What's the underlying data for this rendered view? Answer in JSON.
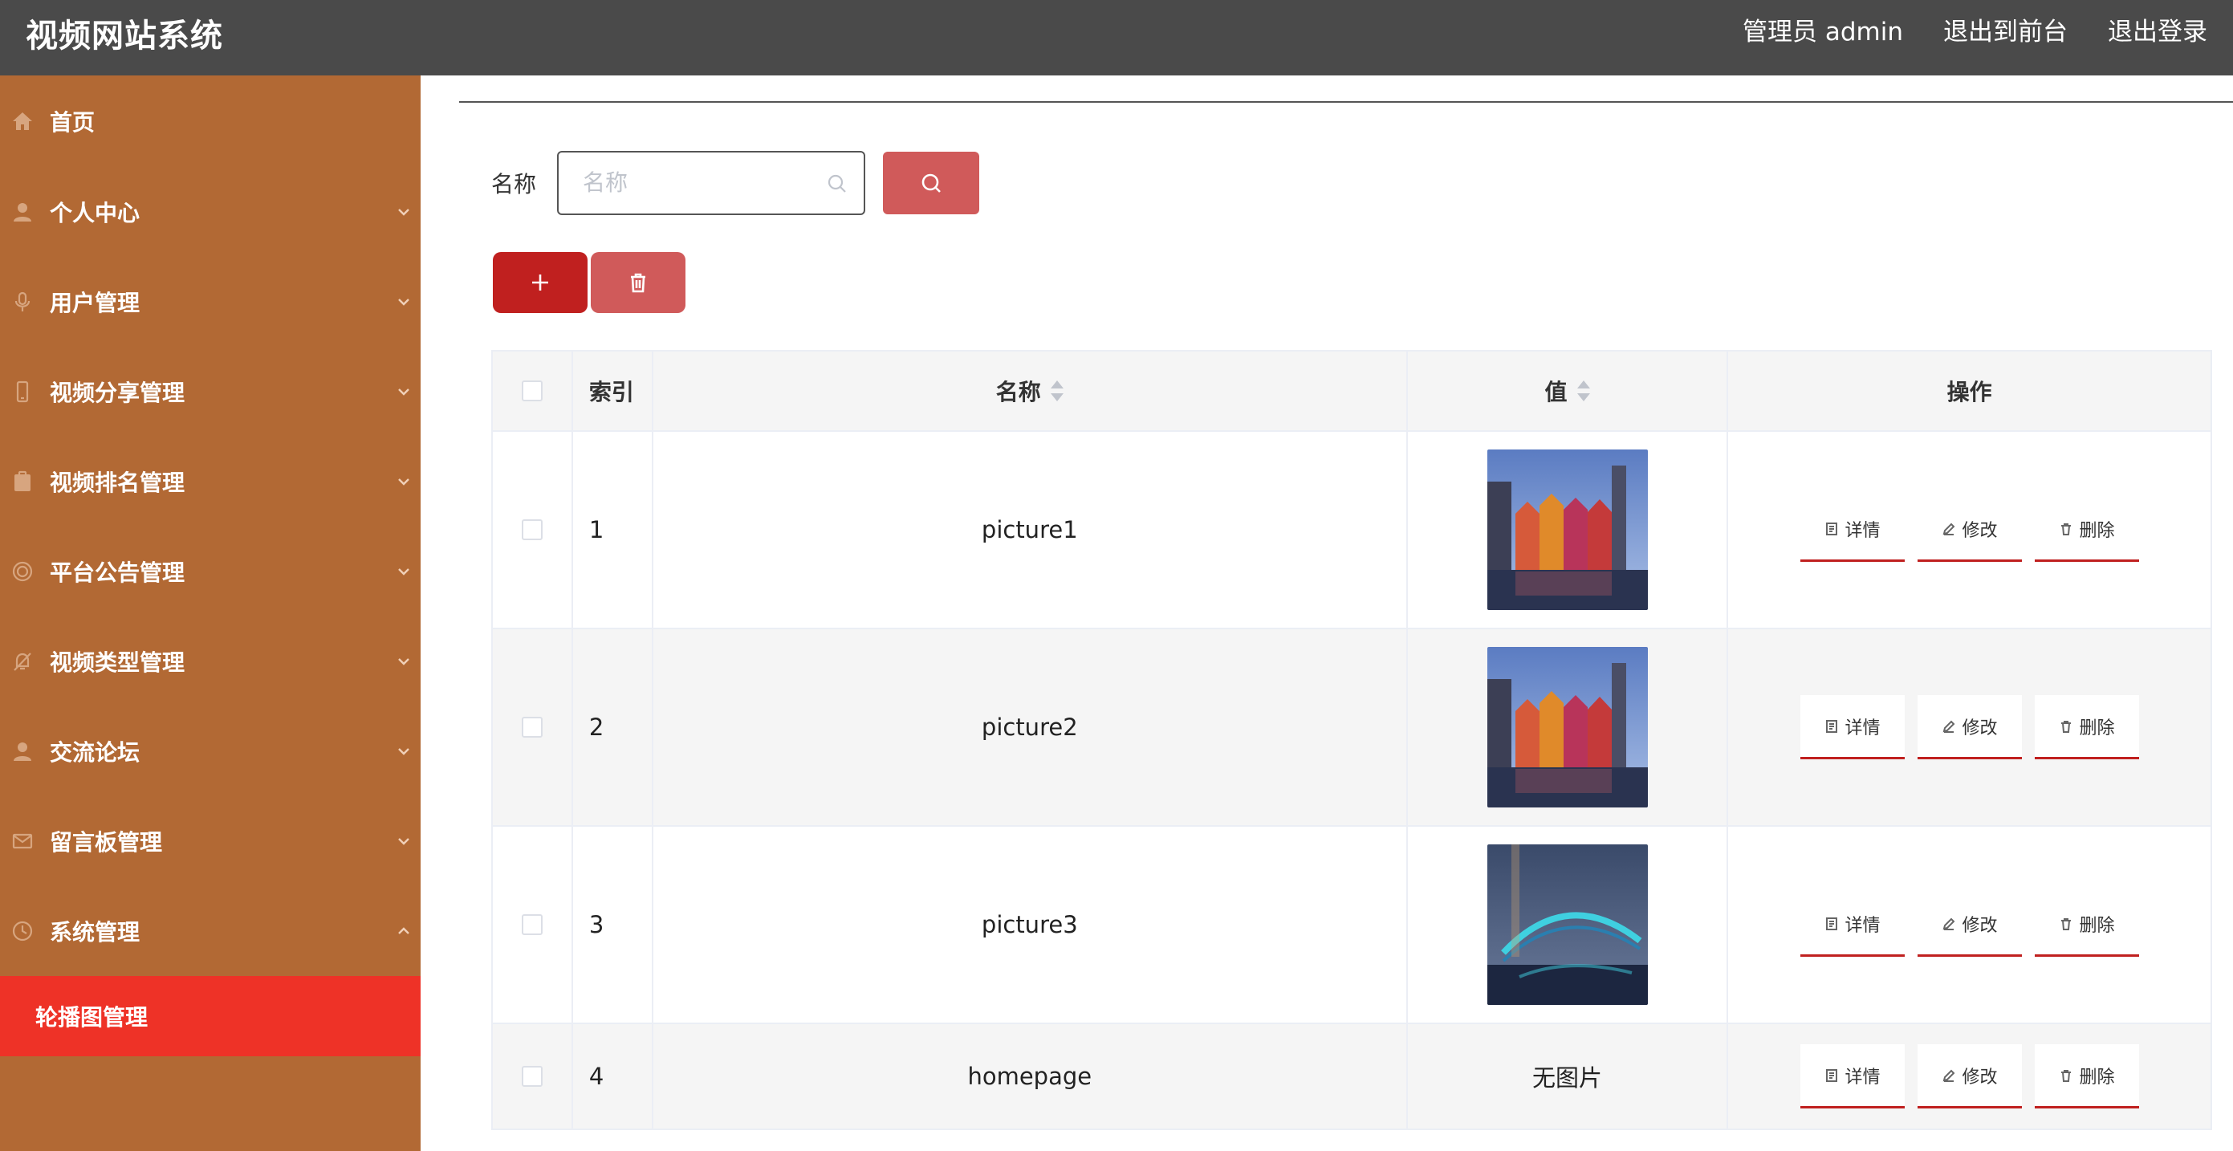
{
  "header": {
    "title": "视频网站系统",
    "admin_label": "管理员 admin",
    "to_front": "退出到前台",
    "logout": "退出登录"
  },
  "sidebar": {
    "items": [
      {
        "label": "首页",
        "icon": "home-icon",
        "expandable": false
      },
      {
        "label": "个人中心",
        "icon": "user-icon",
        "expandable": true
      },
      {
        "label": "用户管理",
        "icon": "microphone-icon",
        "expandable": true
      },
      {
        "label": "视频分享管理",
        "icon": "phone-icon",
        "expandable": true
      },
      {
        "label": "视频排名管理",
        "icon": "clipboard-icon",
        "expandable": true
      },
      {
        "label": "平台公告管理",
        "icon": "circle-icon",
        "expandable": true
      },
      {
        "label": "视频类型管理",
        "icon": "bell-off-icon",
        "expandable": true
      },
      {
        "label": "交流论坛",
        "icon": "user-icon",
        "expandable": true
      },
      {
        "label": "留言板管理",
        "icon": "mail-icon",
        "expandable": true
      },
      {
        "label": "系统管理",
        "icon": "clock-icon",
        "expandable": true,
        "expanded": true
      }
    ],
    "active_submenu": "轮播图管理"
  },
  "search": {
    "label": "名称",
    "placeholder": "名称",
    "value": ""
  },
  "table": {
    "headers": {
      "index": "索引",
      "name": "名称",
      "value": "值",
      "actions": "操作"
    },
    "rows": [
      {
        "index": "1",
        "name": "picture1",
        "image": "colorful-houses"
      },
      {
        "index": "2",
        "name": "picture2",
        "image": "colorful-houses"
      },
      {
        "index": "3",
        "name": "picture3",
        "image": "lit-bridge"
      },
      {
        "index": "4",
        "name": "homepage",
        "value_text": "无图片"
      }
    ],
    "actions": {
      "detail": "详情",
      "edit": "修改",
      "delete": "删除"
    }
  },
  "colors": {
    "topbar": "#4a4a4a",
    "sidebar": "#b26934",
    "active_submenu": "#ee3227",
    "primary_button": "#c0201f",
    "secondary_button": "#d05a5a"
  }
}
